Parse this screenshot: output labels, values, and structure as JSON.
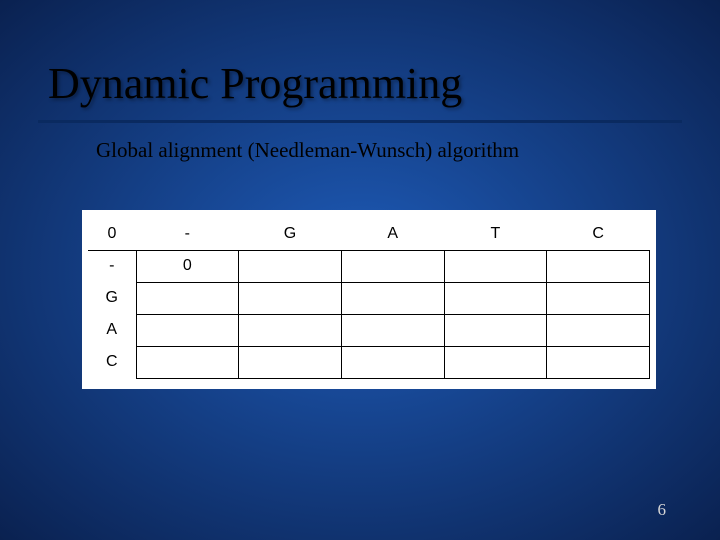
{
  "title": "Dynamic Programming",
  "subtitle": "Global alignment (Needleman-Wunsch) algorithm",
  "page_number": "6",
  "chart_data": {
    "type": "table",
    "col_headers": [
      "0",
      "-",
      "G",
      "A",
      "T",
      "C"
    ],
    "row_headers": [
      "-",
      "G",
      "A",
      "C"
    ],
    "cells": [
      [
        "0",
        "",
        "",
        "",
        ""
      ],
      [
        "",
        "",
        "",
        "",
        ""
      ],
      [
        "",
        "",
        "",
        "",
        ""
      ],
      [
        "",
        "",
        "",
        "",
        ""
      ]
    ]
  }
}
